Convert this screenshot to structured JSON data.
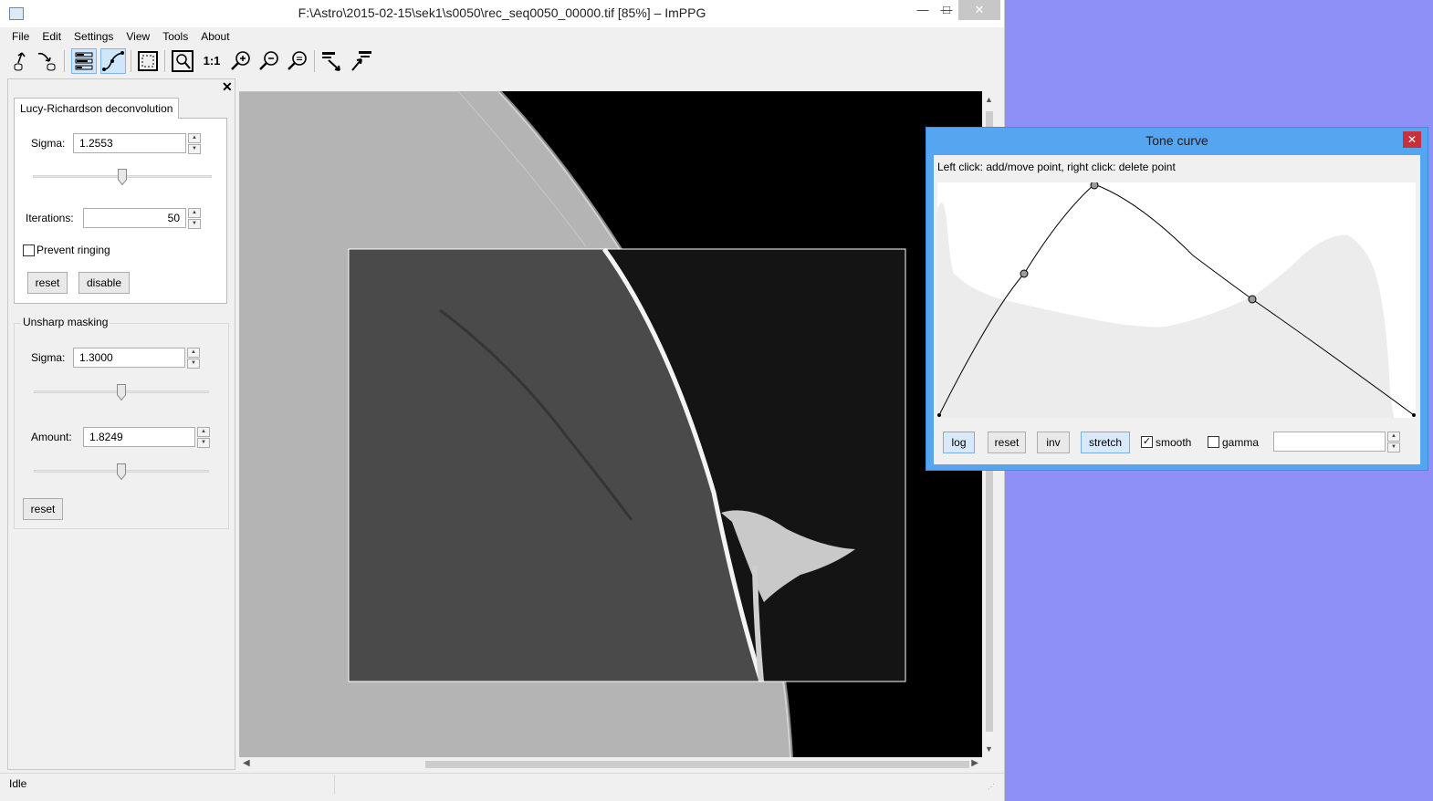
{
  "window": {
    "title": "F:\\Astro\\2015-02-15\\sek1\\s0050\\rec_seq0050_00000.tif [85%] – ImPPG",
    "minimize": "—",
    "maximize": "□",
    "close": "✕"
  },
  "menu": [
    "File",
    "Edit",
    "Settings",
    "View",
    "Tools",
    "About"
  ],
  "toolbar": {
    "buttons": [
      {
        "icon": "open-file-icon"
      },
      {
        "icon": "save-file-icon"
      },
      {
        "icon": "processing-settings-icon",
        "active": true
      },
      {
        "icon": "tone-curve-icon",
        "active": true
      },
      {
        "icon": "select-region-icon"
      },
      {
        "icon": "fit-window-icon"
      },
      {
        "icon": "zoom-actual-size-icon",
        "label": "1:1"
      },
      {
        "icon": "zoom-in-icon"
      },
      {
        "icon": "zoom-out-icon"
      },
      {
        "icon": "zoom-custom-icon"
      },
      {
        "icon": "align-images-icon"
      },
      {
        "icon": "batch-process-icon"
      }
    ]
  },
  "panel": {
    "close": "✕",
    "lr": {
      "tab": "Lucy-Richardson deconvolution",
      "sigma_label": "Sigma:",
      "sigma": "1.2553",
      "sigma_slider": 0.5,
      "iterations_label": "Iterations:",
      "iterations": "50",
      "prevent_ringing": "Prevent ringing",
      "prevent_ringing_checked": false,
      "reset": "reset",
      "disable": "disable"
    },
    "unsharp": {
      "title": "Unsharp masking",
      "sigma_label": "Sigma:",
      "sigma": "1.3000",
      "sigma_slider": 0.5,
      "amount_label": "Amount:",
      "amount": "1.8249",
      "amount_slider": 0.5,
      "reset": "reset"
    }
  },
  "status": {
    "text": "Idle"
  },
  "tone_curve": {
    "title": "Tone curve",
    "close": "✕",
    "hint": "Left click: add/move point, right click: delete point",
    "buttons": {
      "log": "log",
      "reset": "reset",
      "inv": "inv",
      "stretch": "stretch"
    },
    "smooth": "smooth",
    "smooth_checked": true,
    "gamma": "gamma",
    "gamma_checked": false,
    "gamma_value": ""
  }
}
